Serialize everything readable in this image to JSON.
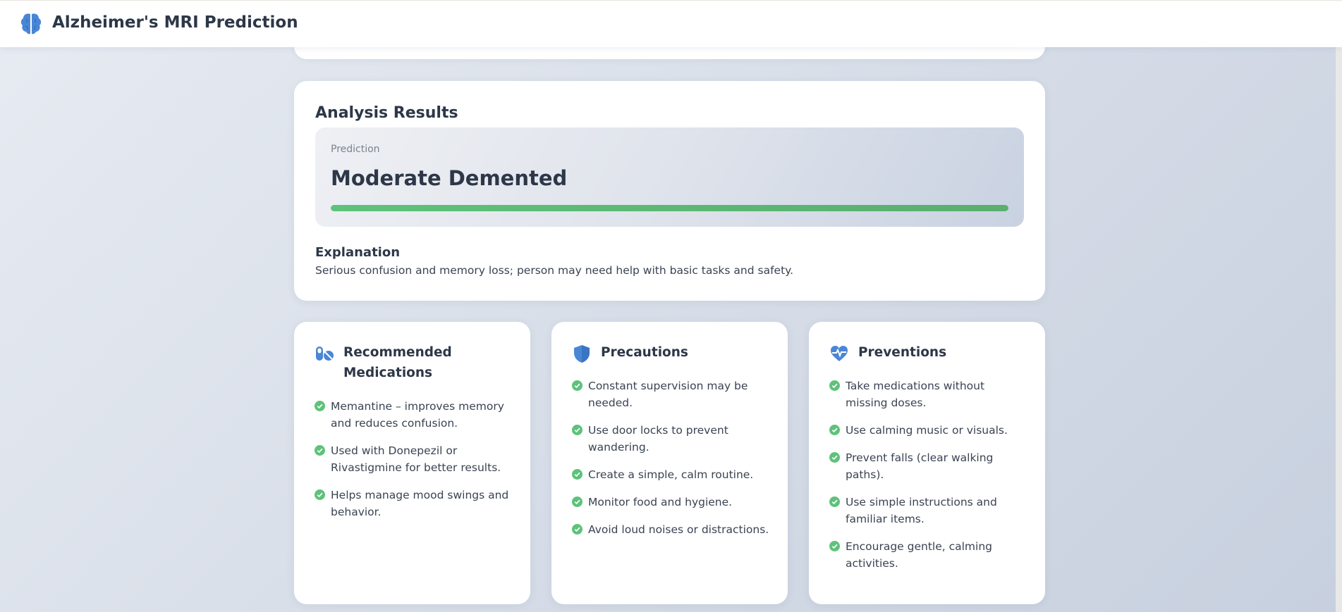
{
  "app": {
    "title": "Alzheimer's MRI Prediction",
    "icon": "brain-icon"
  },
  "colors": {
    "accent": "#4a86d6",
    "success": "#5ec27a",
    "text": "#2d3748"
  },
  "analysis": {
    "title": "Analysis Results",
    "prediction_label": "Prediction",
    "prediction_value": "Moderate Demented",
    "confidence_fill": 1.0,
    "explanation_heading": "Explanation",
    "explanation_text": "Serious confusion and memory loss; person may need help with basic tasks and safety."
  },
  "cards": {
    "medications": {
      "icon": "pills-icon",
      "title": "Recommended Medications",
      "items": [
        "Memantine – improves memory and reduces confusion.",
        "Used with Donepezil or Rivastigmine for better results.",
        "Helps manage mood swings and behavior."
      ]
    },
    "precautions": {
      "icon": "shield-icon",
      "title": "Precautions",
      "items": [
        "Constant supervision may be needed.",
        "Use door locks to prevent wandering.",
        "Create a simple, calm routine.",
        "Monitor food and hygiene.",
        "Avoid loud noises or distractions."
      ]
    },
    "preventions": {
      "icon": "heart-pulse-icon",
      "title": "Preventions",
      "items": [
        "Take medications without missing doses.",
        "Use calming music or visuals.",
        "Prevent falls (clear walking paths).",
        "Use simple instructions and familiar items.",
        "Encourage gentle, calming activities."
      ]
    }
  }
}
